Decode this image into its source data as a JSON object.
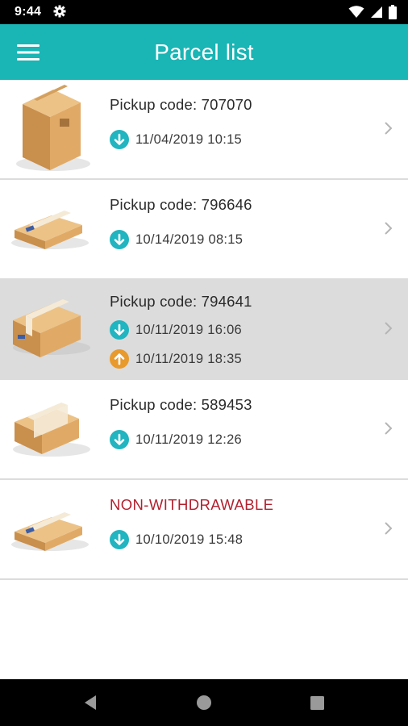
{
  "status_bar": {
    "time": "9:44"
  },
  "app_bar": {
    "title": "Parcel list"
  },
  "colors": {
    "accent": "#1ab5b5",
    "deposit": "#20b5c0",
    "withdraw": "#e89a2c",
    "warning": "#b3202e",
    "selected_row": "#dcdcdc"
  },
  "parcels": [
    {
      "title": "Pickup code: 707070",
      "selected": false,
      "icon": "tall-box-icon",
      "events": [
        {
          "type": "deposit",
          "icon": "arrow-down-icon",
          "datetime": "11/04/2019 10:15"
        }
      ]
    },
    {
      "title": "Pickup code: 796646",
      "selected": false,
      "icon": "flat-box-icon",
      "events": [
        {
          "type": "deposit",
          "icon": "arrow-down-icon",
          "datetime": "10/14/2019 08:15"
        }
      ]
    },
    {
      "title": "Pickup code: 794641",
      "selected": true,
      "icon": "medium-box-icon",
      "events": [
        {
          "type": "deposit",
          "icon": "arrow-down-icon",
          "datetime": "10/11/2019 16:06"
        },
        {
          "type": "withdraw",
          "icon": "arrow-up-icon",
          "datetime": "10/11/2019 18:35"
        }
      ]
    },
    {
      "title": "Pickup code: 589453",
      "selected": false,
      "icon": "medium-box-icon",
      "events": [
        {
          "type": "deposit",
          "icon": "arrow-down-icon",
          "datetime": "10/11/2019 12:26"
        }
      ]
    },
    {
      "title": "NON-WITHDRAWABLE",
      "selected": false,
      "warning": true,
      "icon": "flat-box-icon",
      "events": [
        {
          "type": "deposit",
          "icon": "arrow-down-icon",
          "datetime": "10/10/2019 15:48"
        }
      ]
    }
  ]
}
